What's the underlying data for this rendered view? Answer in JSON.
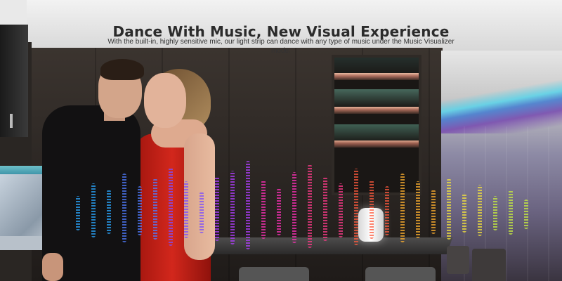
{
  "banner": {
    "title": "Dance With Music, New Visual Experience",
    "description": "With the built-in, highly sensitive mic, our light strip can dance with any type of music under the Music Visualizer mode."
  },
  "visualizer": {
    "colors": [
      "#2aa8ff",
      "#4f7cff",
      "#7a4dff",
      "#b13dff",
      "#ff2fb8",
      "#ff3a8a",
      "#ff5a3d",
      "#ffb02e",
      "#f4e23a",
      "#c9ef3e"
    ],
    "levels": [
      0.35,
      0.55,
      0.45,
      0.7,
      0.5,
      0.62,
      0.8,
      0.58,
      0.42,
      0.66,
      0.75,
      0.9,
      0.6,
      0.48,
      0.72,
      0.85,
      0.65,
      0.55,
      0.78,
      0.6,
      0.5,
      0.7,
      0.58,
      0.45,
      0.62,
      0.4,
      0.52,
      0.35,
      0.46,
      0.3
    ]
  }
}
